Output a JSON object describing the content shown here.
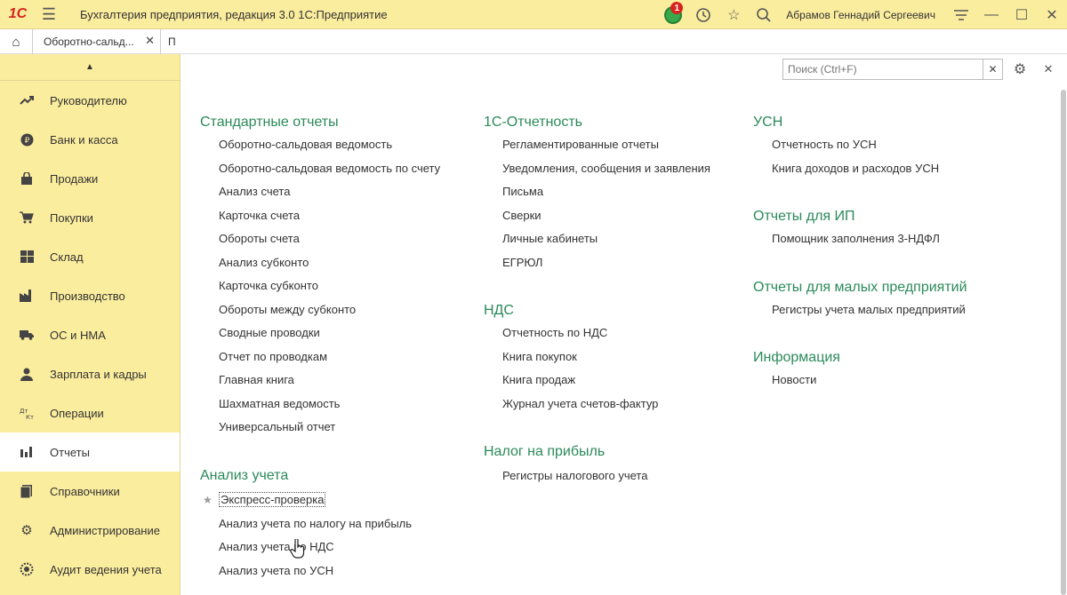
{
  "titlebar": {
    "logo": "1С",
    "title": "Бухгалтерия предприятия, редакция 3.0 1С:Предприятие",
    "notification_count": "1",
    "user": "Абрамов Геннадий Сергеевич",
    "icons": [
      "hamburger-icon",
      "history-icon",
      "star-icon",
      "search-icon",
      "settings-lines-icon",
      "minimize-icon",
      "maximize-icon",
      "close-icon"
    ]
  },
  "tabs": {
    "home_icon": "home-icon",
    "open": [
      {
        "label": "Оборотно-сальд..."
      },
      {
        "label": "П"
      }
    ]
  },
  "sidebar": {
    "items": [
      {
        "label": "Руководителю",
        "icon": "trend-icon"
      },
      {
        "label": "Банк и касса",
        "icon": "ruble-icon"
      },
      {
        "label": "Продажи",
        "icon": "bag-icon"
      },
      {
        "label": "Покупки",
        "icon": "cart-icon"
      },
      {
        "label": "Склад",
        "icon": "warehouse-icon"
      },
      {
        "label": "Производство",
        "icon": "factory-icon"
      },
      {
        "label": "ОС и НМА",
        "icon": "truck-icon"
      },
      {
        "label": "Зарплата и кадры",
        "icon": "person-icon"
      },
      {
        "label": "Операции",
        "icon": "dt-kt-icon"
      },
      {
        "label": "Отчеты",
        "icon": "bar-chart-icon",
        "active": true
      },
      {
        "label": "Справочники",
        "icon": "book-icon"
      },
      {
        "label": "Администрирование",
        "icon": "gear-icon"
      },
      {
        "label": "Аудит ведения учета",
        "icon": "audit-icon"
      }
    ]
  },
  "main": {
    "search_placeholder": "Поиск (Ctrl+F)",
    "columns": {
      "col1": [
        {
          "title": "Стандартные отчеты",
          "links": [
            "Оборотно-сальдовая ведомость",
            "Оборотно-сальдовая ведомость по счету",
            "Анализ счета",
            "Карточка счета",
            "Обороты счета",
            "Анализ субконто",
            "Карточка субконто",
            "Обороты между субконто",
            "Сводные проводки",
            "Отчет по проводкам",
            "Главная книга",
            "Шахматная ведомость",
            "Универсальный отчет"
          ]
        },
        {
          "title": "Анализ учета",
          "links": [
            "Экспресс-проверка",
            "Анализ учета по налогу на прибыль",
            "Анализ учета по НДС",
            "Анализ учета по УСН"
          ]
        }
      ],
      "col2": [
        {
          "title": "1С-Отчетность",
          "links": [
            "Регламентированные отчеты",
            "Уведомления, сообщения и заявления",
            "Письма",
            "Сверки",
            "Личные кабинеты",
            "ЕГРЮЛ"
          ]
        },
        {
          "title": "НДС",
          "links": [
            "Отчетность по НДС",
            "Книга покупок",
            "Книга продаж",
            "Журнал учета счетов-фактур"
          ]
        },
        {
          "title": "Налог на прибыль",
          "links": [
            "Регистры налогового учета"
          ]
        }
      ],
      "col3": [
        {
          "title": "УСН",
          "links": [
            "Отчетность по УСН",
            "Книга доходов и расходов УСН"
          ]
        },
        {
          "title": "Отчеты для ИП",
          "links": [
            "Помощник заполнения 3-НДФЛ"
          ]
        },
        {
          "title": "Отчеты для малых предприятий",
          "links": [
            "Регистры учета малых предприятий"
          ]
        },
        {
          "title": "Информация",
          "links": [
            "Новости"
          ]
        }
      ]
    },
    "colors": {
      "section_title": "#2b8a5a",
      "sidebar_bg": "#fbed9e",
      "logo_red": "#d6231c"
    }
  }
}
